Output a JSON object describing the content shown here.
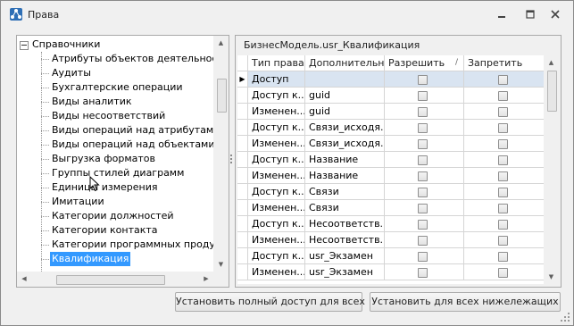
{
  "window": {
    "title": "Права",
    "icon": "app-network-icon",
    "controls": [
      "minimize-icon",
      "maximize-icon",
      "close-icon"
    ]
  },
  "tree": {
    "root": "Справочники",
    "items": [
      "Атрибуты объектов деятельности",
      "Аудиты",
      "Бухгалтерские операции",
      "Виды аналитик",
      "Виды несоответствий",
      "Виды операций над атрибутами",
      "Виды операций над объектами",
      "Выгрузка форматов",
      "Группы стилей диаграмм",
      "Единицы измерения",
      "Имитации",
      "Категории должностей",
      "Категории контакта",
      "Категории программных продуктов",
      "Квалификация"
    ],
    "selected_item": "Квалификация"
  },
  "grid": {
    "title": "БизнесМодель.usr_Квалификация",
    "columns": [
      "Тип права",
      "Дополнительн...",
      "Разрешить",
      "Запретить"
    ],
    "sort_glyph": "/",
    "rows": [
      {
        "type": "Доступ",
        "extra": "",
        "allow": false,
        "deny": false,
        "current": true
      },
      {
        "type": "Доступ к...",
        "extra": "guid",
        "allow": false,
        "deny": false
      },
      {
        "type": "Изменен...",
        "extra": "guid",
        "allow": false,
        "deny": false
      },
      {
        "type": "Доступ к...",
        "extra": "Связи_исходя...",
        "allow": false,
        "deny": false
      },
      {
        "type": "Изменен...",
        "extra": "Связи_исходя...",
        "allow": false,
        "deny": false
      },
      {
        "type": "Доступ к...",
        "extra": "Название",
        "allow": false,
        "deny": false
      },
      {
        "type": "Изменен...",
        "extra": "Название",
        "allow": false,
        "deny": false
      },
      {
        "type": "Доступ к...",
        "extra": "Связи",
        "allow": false,
        "deny": false
      },
      {
        "type": "Изменен...",
        "extra": "Связи",
        "allow": false,
        "deny": false
      },
      {
        "type": "Доступ к...",
        "extra": "Несоответств...",
        "allow": false,
        "deny": false
      },
      {
        "type": "Изменен...",
        "extra": "Несоответств...",
        "allow": false,
        "deny": false
      },
      {
        "type": "Доступ к...",
        "extra": "usr_Экзамен",
        "allow": false,
        "deny": false
      },
      {
        "type": "Изменен...",
        "extra": "usr_Экзамен",
        "allow": false,
        "deny": false
      }
    ]
  },
  "buttons": {
    "grant_full_access": "Установить полный доступ для всех",
    "set_for_subordinates": "Установить для всех нижележащих"
  },
  "colors": {
    "selection": "#3399ff",
    "current_row": "#d9e4f1",
    "window_bg": "#f0f0f0"
  }
}
